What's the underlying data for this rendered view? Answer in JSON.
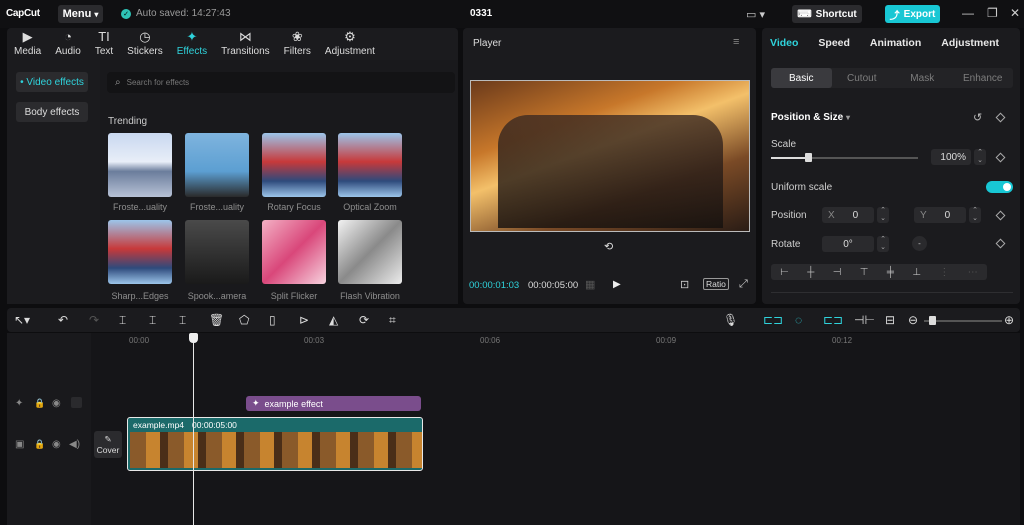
{
  "titlebar": {
    "logo": "CapCut",
    "menu_label": "Menu",
    "autosave": "Auto saved: 14:27:43",
    "project_name": "0331",
    "shortcut_label": "Shortcut",
    "export_label": "Export"
  },
  "tools": [
    {
      "label": "Media",
      "icon": "media-icon"
    },
    {
      "label": "Audio",
      "icon": "audio-icon"
    },
    {
      "label": "Text",
      "icon": "text-icon"
    },
    {
      "label": "Stickers",
      "icon": "stickers-icon"
    },
    {
      "label": "Effects",
      "icon": "effects-icon"
    },
    {
      "label": "Transitions",
      "icon": "transitions-icon"
    },
    {
      "label": "Filters",
      "icon": "filters-icon"
    },
    {
      "label": "Adjustment",
      "icon": "adjustment-icon"
    }
  ],
  "effects_sidebar": {
    "video_effects": "• Video effects",
    "body_effects": "Body effects"
  },
  "search": {
    "placeholder": "Search for effects"
  },
  "section_title": "Trending",
  "effects": [
    {
      "label": "Froste...uality"
    },
    {
      "label": "Froste...uality"
    },
    {
      "label": "Rotary Focus"
    },
    {
      "label": "Optical Zoom"
    },
    {
      "label": "Sharp...Edges"
    },
    {
      "label": "Spook...amera"
    },
    {
      "label": "Split Flicker"
    },
    {
      "label": "Flash Vibration"
    }
  ],
  "player": {
    "title": "Player",
    "current_time": "00:00:01:03",
    "total_time": "00:00:05:00",
    "ratio_label": "Ratio"
  },
  "inspector": {
    "tabs": [
      "Video",
      "Speed",
      "Animation",
      "Adjustment"
    ],
    "subtabs": [
      "Basic",
      "Cutout",
      "Mask",
      "Enhance"
    ],
    "position_size": "Position & Size",
    "scale_label": "Scale",
    "scale_value": "100%",
    "scale_fraction": 0.25,
    "uniform_scale": "Uniform scale",
    "position_label": "Position",
    "x_label": "X",
    "x_value": "0",
    "y_label": "Y",
    "y_value": "0",
    "rotate_label": "Rotate",
    "rotate_value": "0°"
  },
  "ruler": [
    "00:00",
    "00:03",
    "00:06",
    "00:09",
    "00:12"
  ],
  "timeline": {
    "effect_name": "example effect",
    "clip_name": "example.mp4",
    "clip_duration": "00:00:05:00",
    "cover_label": "Cover"
  },
  "colors": {
    "accent": "#18c7d4",
    "effect_bar": "#7a4d8c",
    "clip": "#1b6a6a"
  }
}
